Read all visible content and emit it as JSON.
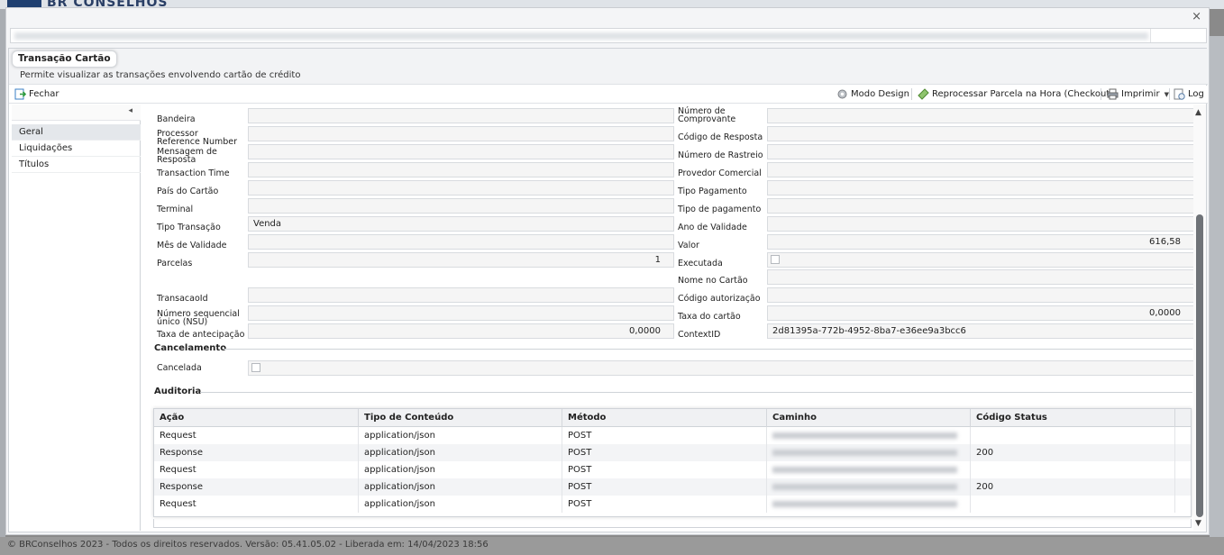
{
  "background": {
    "logo": "BR CONSELHOS",
    "footer": "© BRConselhos 2023 - Todos os direitos reservados. Versão: 05.41.05.02 - Liberada em: 14/04/2023 18:56"
  },
  "window": {
    "close_label": "×"
  },
  "page": {
    "title": "Transação Cartão",
    "subtitle": "Permite visualizar as transações envolvendo cartão de crédito"
  },
  "toolbar": {
    "fechar": "Fechar",
    "modo_design": "Modo Design",
    "reprocessar": "Reprocessar Parcela na Hora (Checkout)",
    "imprimir": "Imprimir",
    "log": "Log"
  },
  "sidebar": {
    "collapse_label": "◂",
    "items": [
      {
        "label": "Geral"
      },
      {
        "label": "Liquidações"
      },
      {
        "label": "Títulos"
      }
    ]
  },
  "form": {
    "left": [
      {
        "label": "Bandeira",
        "value": ""
      },
      {
        "label": "Processor Reference Number",
        "value": ""
      },
      {
        "label": "Mensagem de Resposta",
        "value": ""
      },
      {
        "label": "Transaction Time",
        "value": ""
      },
      {
        "label": "País do Cartão",
        "value": ""
      },
      {
        "label": "Terminal",
        "value": ""
      },
      {
        "label": "Tipo Transação",
        "value": "Venda"
      },
      {
        "label": "Mês de Validade",
        "value": ""
      },
      {
        "label": "Parcelas",
        "value": "1"
      },
      {
        "label": "TransacaoId",
        "value": ""
      },
      {
        "label": "Número sequencial único (NSU)",
        "value": ""
      },
      {
        "label": "Taxa de antecipação",
        "value": "0,0000"
      }
    ],
    "right": [
      {
        "label": "Número de Comprovante",
        "value": ""
      },
      {
        "label": "Código de Resposta",
        "value": ""
      },
      {
        "label": "Número de Rastreio",
        "value": ""
      },
      {
        "label": "Provedor Comercial",
        "value": ""
      },
      {
        "label": "Tipo Pagamento",
        "value": ""
      },
      {
        "label": "Tipo de pagamento",
        "value": ""
      },
      {
        "label": "Ano de Validade",
        "value": ""
      },
      {
        "label": "Valor",
        "value": "616,58"
      },
      {
        "label": "Executada",
        "value": ""
      },
      {
        "label": "Nome no Cartão",
        "value": ""
      },
      {
        "label": "Código autorização",
        "value": ""
      },
      {
        "label": "Taxa do cartão",
        "value": "0,0000"
      },
      {
        "label": "ContextID",
        "value": "2d81395a-772b-4952-8ba7-e36ee9a3bcc6"
      }
    ]
  },
  "cancelamento": {
    "title": "Cancelamento",
    "cancelada_label": "Cancelada"
  },
  "auditoria": {
    "title": "Auditoria",
    "columns": [
      "Ação",
      "Tipo de Conteúdo",
      "Método",
      "Caminho",
      "Código Status"
    ],
    "rows": [
      {
        "acao": "Request",
        "tipo": "application/json",
        "metodo": "POST",
        "status": ""
      },
      {
        "acao": "Response",
        "tipo": "application/json",
        "metodo": "POST",
        "status": "200"
      },
      {
        "acao": "Request",
        "tipo": "application/json",
        "metodo": "POST",
        "status": ""
      },
      {
        "acao": "Response",
        "tipo": "application/json",
        "metodo": "POST",
        "status": "200"
      },
      {
        "acao": "Request",
        "tipo": "application/json",
        "metodo": "POST",
        "status": ""
      }
    ]
  },
  "colors": {
    "accent": "#1f3f70",
    "grid_header": "#f0f1f3",
    "field_bg": "#f5f5f5"
  }
}
